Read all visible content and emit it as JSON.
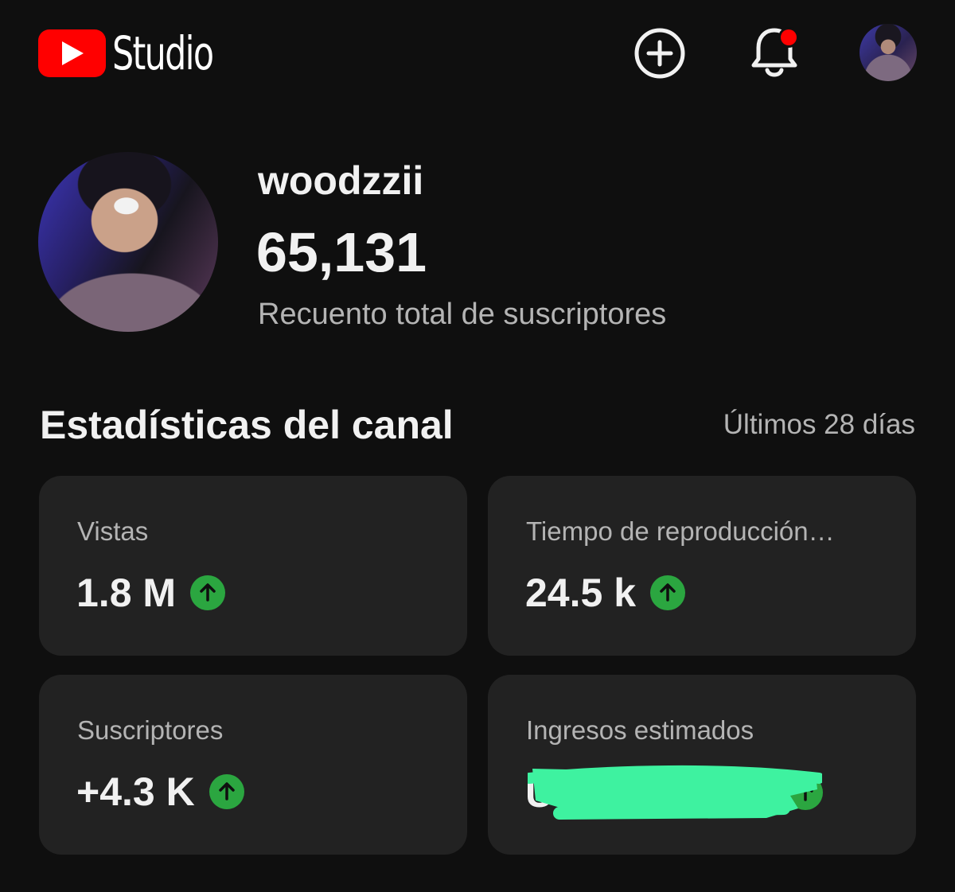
{
  "header": {
    "app_name": "Studio",
    "icons": {
      "logo": "youtube-play-icon",
      "create": "add-circle-icon",
      "notifications": "bell-icon",
      "account": "avatar"
    },
    "notification_dot_color": "#ff0000"
  },
  "channel": {
    "name": "woodzzii",
    "subscriber_count": "65,131",
    "subscriber_label": "Recuento total de suscriptores"
  },
  "stats": {
    "title": "Estadísticas del canal",
    "period": "Últimos 28 días",
    "cards": [
      {
        "label": "Vistas",
        "value": "1.8 M",
        "trend": "up",
        "trend_icon": "arrow-up-icon"
      },
      {
        "label": "Tiempo de reproducción…",
        "value": "24.5 k",
        "trend": "up",
        "trend_icon": "arrow-up-icon"
      },
      {
        "label": "Suscriptores",
        "value": "+4.3 K",
        "trend": "up",
        "trend_icon": "arrow-up-icon"
      },
      {
        "label": "Ingresos estimados",
        "value_redacted": true,
        "trend": "up",
        "trend_icon": "arrow-up-icon"
      }
    ]
  },
  "colors": {
    "background": "#0f0f0f",
    "card": "#222222",
    "brand_red": "#ff0000",
    "trend_up": "#2ba640",
    "redaction": "#3ef2a0"
  }
}
